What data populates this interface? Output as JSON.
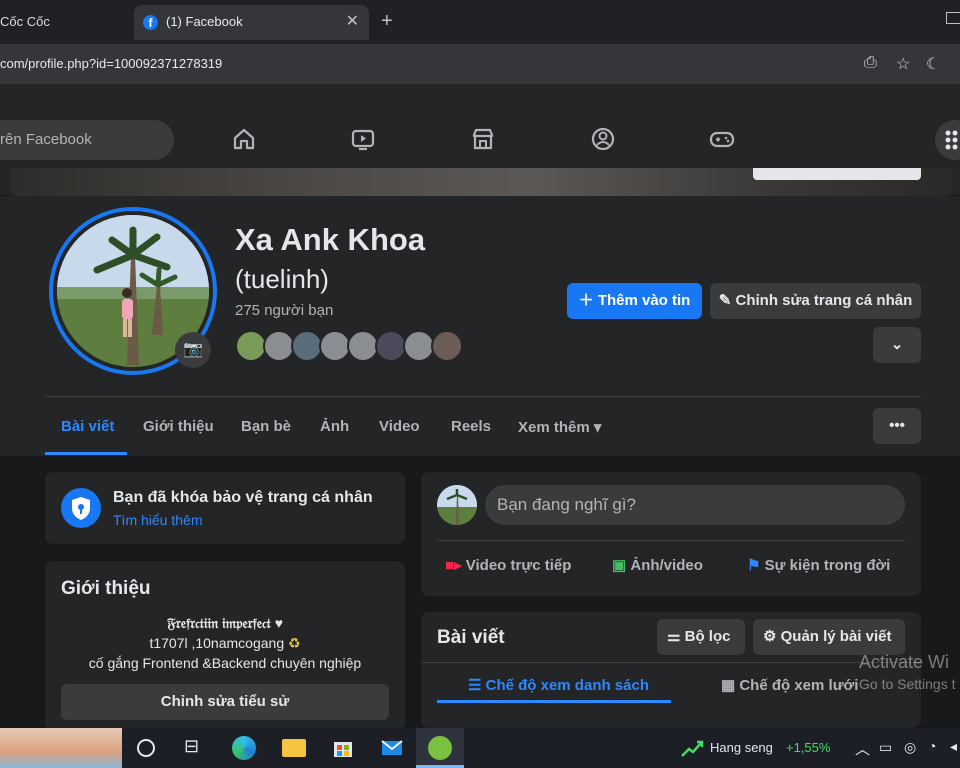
{
  "browser": {
    "inactive_tab": "Cốc Cốc",
    "active_tab": "(1) Facebook",
    "url": "com/profile.php?id=100092371278319"
  },
  "fb_header": {
    "search_placeholder": "rên Facebook"
  },
  "profile": {
    "name": "Xa Ank Khoa",
    "nickname": "(tuelinh)",
    "friends": "275 người bạn",
    "add_story": "Thêm vào tin",
    "edit_profile": "Chỉnh sửa trang cá nhân"
  },
  "tabs": [
    "Bài viết",
    "Giới thiệu",
    "Bạn bè",
    "Ảnh",
    "Video",
    "Reels",
    "Xem thêm"
  ],
  "lock_card": {
    "title": "Bạn đã khóa bảo vệ trang cá nhân",
    "link": "Tìm hiểu thêm"
  },
  "intro": {
    "title": "Giới thiệu",
    "bio_line1": "𝔉𝔯𝔢𝔣𝔯𝔠𝔱𝔦𝔦𝔫 𝔦𝔪𝔭𝔢𝔯𝔣𝔢𝔠𝔱",
    "bio_line2": "t1707l ,10namcogang",
    "bio_line3": "cố gắng Frontend &Backend chuyên nghiệp",
    "edit_bio": "Chỉnh sửa tiểu sử"
  },
  "composer": {
    "placeholder": "Bạn đang nghĩ gì?",
    "live": "Video trực tiếp",
    "photo": "Ảnh/video",
    "life_event": "Sự kiện trong đời"
  },
  "posts": {
    "title": "Bài viết",
    "filter": "Bộ lọc",
    "manage": "Quản lý bài viết",
    "list_view": "Chế độ xem danh sách",
    "grid_view": "Chế độ xem lưới"
  },
  "watermark": {
    "line1": "Activate Wi",
    "line2": "Go to Settings t"
  },
  "taskbar": {
    "ticker": "Hang seng",
    "ticker_change": "+1,55%"
  },
  "colors": {
    "accent": "#1877f2",
    "link": "#2d88ff",
    "card": "#242526",
    "bg": "#18191a"
  }
}
